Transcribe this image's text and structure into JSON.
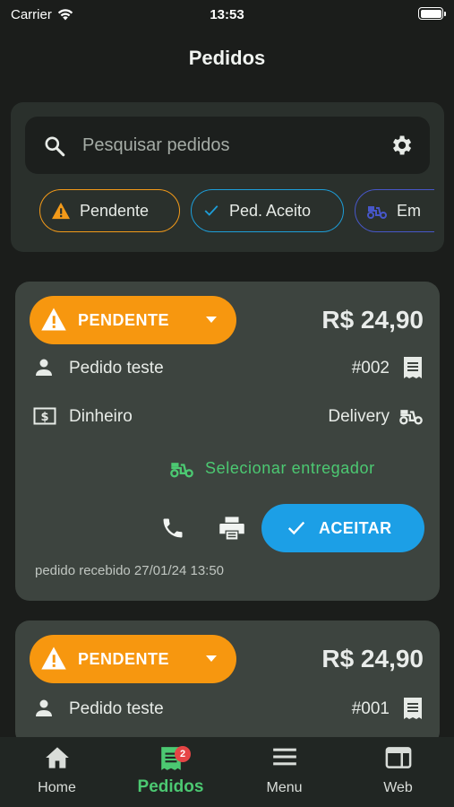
{
  "status_bar": {
    "carrier": "Carrier",
    "time": "13:53"
  },
  "header": {
    "title": "Pedidos"
  },
  "search": {
    "placeholder": "Pesquisar pedidos"
  },
  "filters": [
    {
      "label": "Pendente",
      "color": "#f39a19",
      "icon": "warning-icon"
    },
    {
      "label": "Ped. Aceito",
      "color": "#1d9ed9",
      "icon": "check-icon"
    },
    {
      "label": "Em",
      "color": "#4757c9",
      "icon": "delivery-scooter-icon"
    }
  ],
  "orders": [
    {
      "status": "PENDENTE",
      "price": "R$ 24,90",
      "customer": "Pedido teste",
      "number": "#002",
      "payment": "Dinheiro",
      "type": "Delivery",
      "courier_action": "Selecionar entregador",
      "accept_label": "ACEITAR",
      "received": "pedido recebido 27/01/24 13:50"
    },
    {
      "status": "PENDENTE",
      "price": "R$ 24,90",
      "customer": "Pedido teste",
      "number": "#001"
    }
  ],
  "bottom_nav": {
    "items": [
      {
        "label": "Home",
        "icon": "home-icon"
      },
      {
        "label": "Pedidos",
        "icon": "receipt-icon",
        "badge": "2",
        "active": true
      },
      {
        "label": "Menu",
        "icon": "menu-icon"
      },
      {
        "label": "Web",
        "icon": "web-window-icon"
      }
    ]
  },
  "colors": {
    "accent": "#4cc972",
    "pending": "#f7970f",
    "accept": "#1c9fe6",
    "card": "#3d443f",
    "background": "#1b1d1b"
  }
}
